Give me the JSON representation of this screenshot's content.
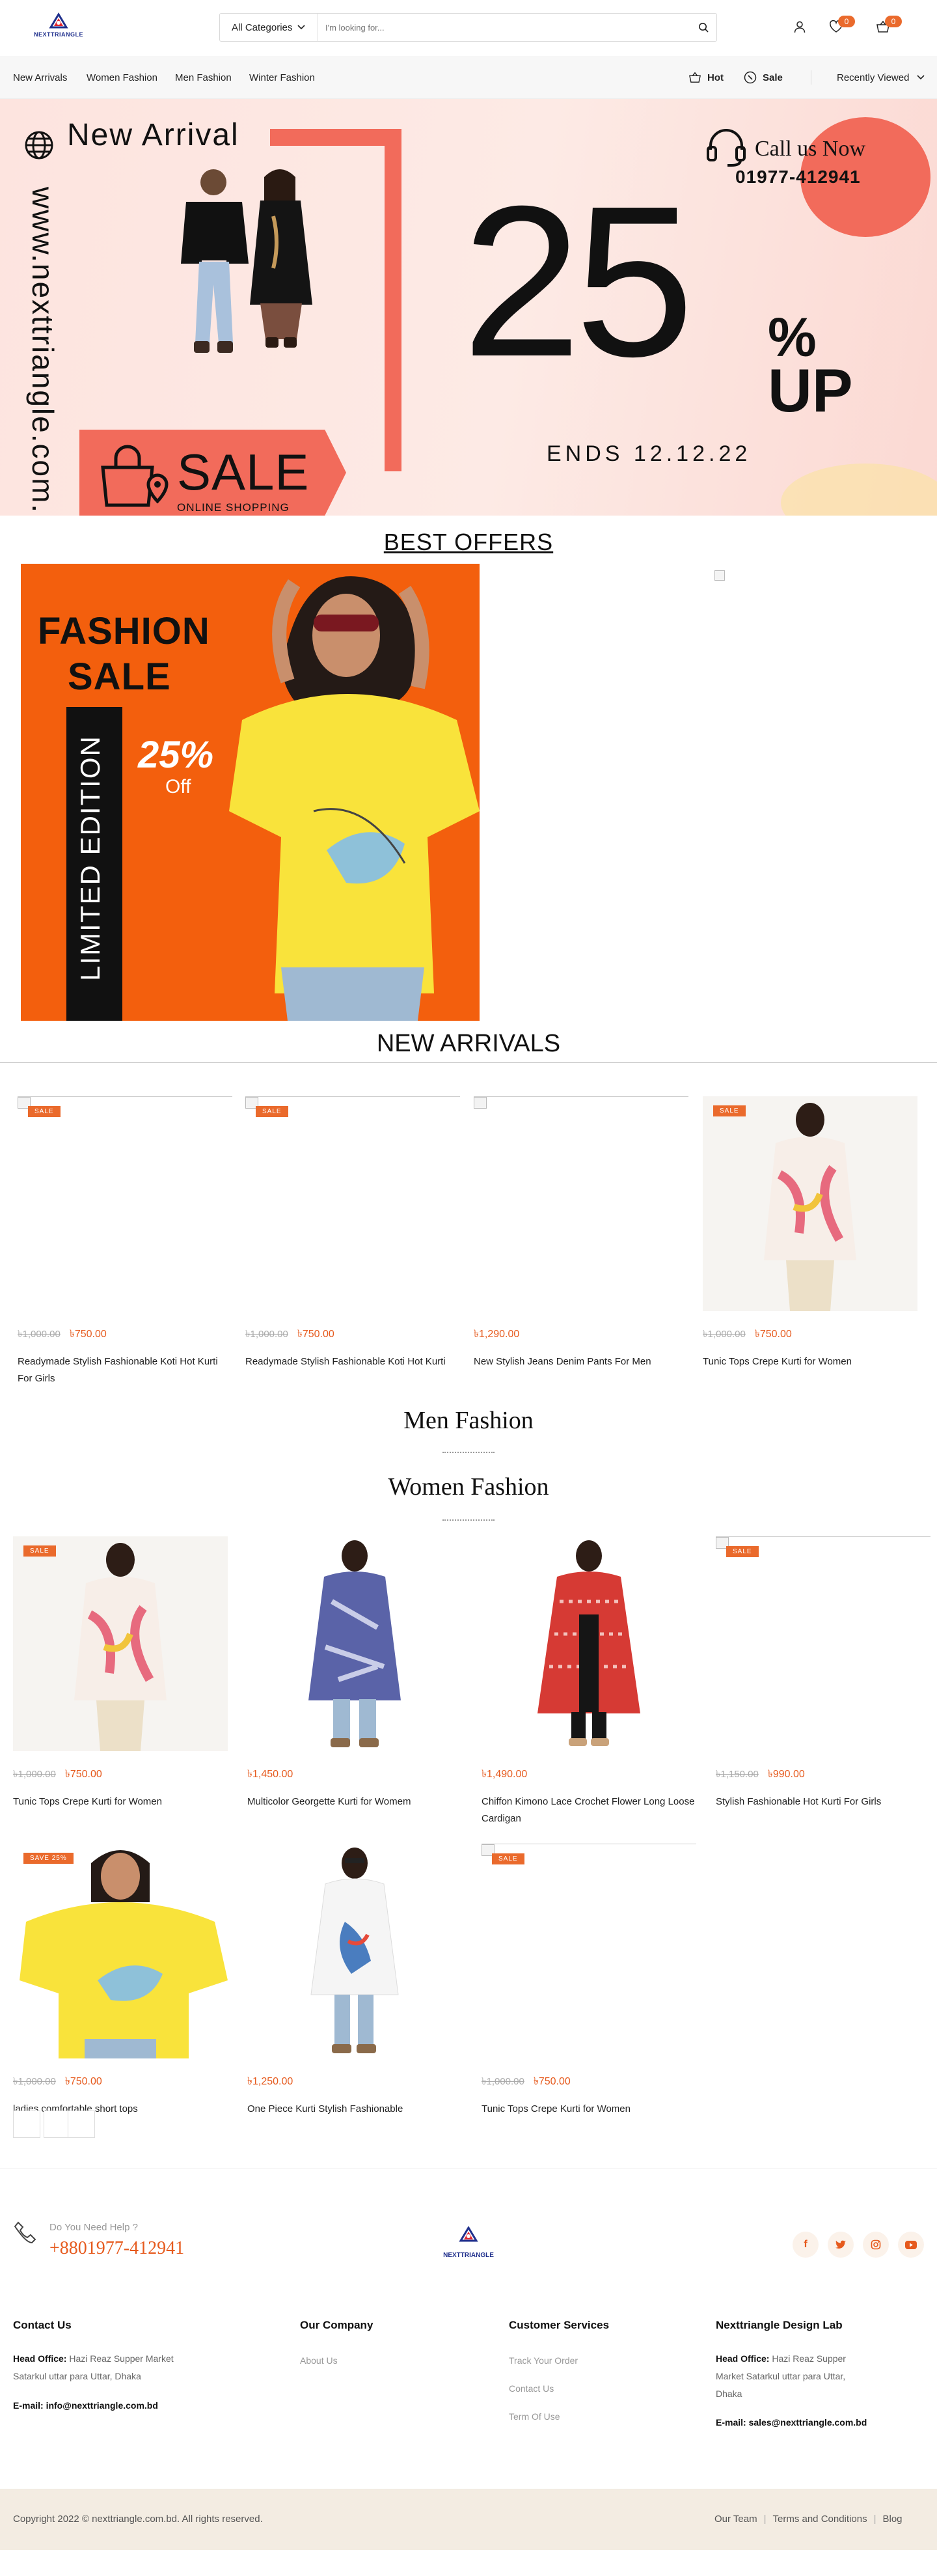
{
  "brand": {
    "logo_text": "NEXTTRIANGLE"
  },
  "search": {
    "category": "All Categories",
    "placeholder": "I'm looking for..."
  },
  "header": {
    "wishlist_count": "0",
    "cart_count": "0"
  },
  "nav": {
    "links": [
      "New Arrivals",
      "Women Fashion",
      "Men Fashion",
      "Winter Fashion"
    ],
    "hot": "Hot",
    "sale": "Sale",
    "recently_viewed": "Recently Viewed"
  },
  "hero": {
    "website": "www.nexttriangle.com.bd",
    "new_arrival": "New Arrival",
    "sale": "SALE",
    "online_shopping": "ONLINE SHOPPING",
    "call_label": "Call us Now",
    "phone": "01977-412941",
    "percent": "25",
    "percent_sign": "%",
    "up": "UP",
    "ends": "ENDS 12.12.22"
  },
  "best_offers": {
    "title": "BEST OFFERS",
    "banner": {
      "line1": "FASHION",
      "line2": "SALE",
      "edition": "LIMITED EDITION",
      "percent": "25%",
      "off": "Off"
    }
  },
  "new_arrivals": {
    "title": "NEW ARRIVALS",
    "products": [
      {
        "sale": "SALE",
        "old": "৳1,000.00",
        "price": "৳750.00",
        "name": "Readymade Stylish Fashionable Koti Hot Kurti For Girls"
      },
      {
        "sale": "SALE",
        "old": "৳1,000.00",
        "price": "৳750.00",
        "name": "Readymade Stylish Fashionable Koti Hot Kurti"
      },
      {
        "sale": "",
        "old": "",
        "price": "৳1,290.00",
        "name": "New Stylish Jeans Denim Pants For Men"
      },
      {
        "sale": "SALE",
        "old": "৳1,000.00",
        "price": "৳750.00",
        "name": "Tunic Tops Crepe Kurti for Women"
      }
    ]
  },
  "men_fashion": {
    "title": "Men Fashion"
  },
  "women_fashion": {
    "title": "Women Fashion",
    "products": [
      {
        "sale": "SALE",
        "old": "৳1,000.00",
        "price": "৳750.00",
        "name": "Tunic Tops Crepe Kurti for Women"
      },
      {
        "sale": "",
        "old": "",
        "price": "৳1,450.00",
        "name": "Multicolor Georgette Kurti for Womem"
      },
      {
        "sale": "",
        "old": "",
        "price": "৳1,490.00",
        "name": "Chiffon Kimono Lace Crochet Flower Long Loose Cardigan"
      },
      {
        "sale": "SALE",
        "old": "৳1,150.00",
        "price": "৳990.00",
        "name": "Stylish Fashionable Hot Kurti For Girls"
      },
      {
        "sale": "SAVE 25%",
        "old": "৳1,000.00",
        "price": "৳750.00",
        "name": "ladies comfortable short tops"
      },
      {
        "sale": "",
        "old": "",
        "price": "৳1,250.00",
        "name": "One Piece Kurti Stylish Fashionable"
      },
      {
        "sale": "SALE",
        "old": "৳1,000.00",
        "price": "৳750.00",
        "name": "Tunic Tops Crepe Kurti for Women"
      }
    ]
  },
  "footer": {
    "help_label": "Do You Need Help ?",
    "help_phone": "+8801977-412941",
    "contact": {
      "title": "Contact Us",
      "office_label": "Head Office:",
      "office": "Hazi Reaz Supper Market Satarkul uttar para Uttar, Dhaka",
      "email_label": "E-mail:",
      "email": "info@nexttriangle.com.bd"
    },
    "company": {
      "title": "Our Company",
      "links": [
        "About Us"
      ]
    },
    "services": {
      "title": "Customer Services",
      "links": [
        "Track Your Order",
        "Contact Us",
        "Term Of Use"
      ]
    },
    "lab": {
      "title": "Nexttriangle Design Lab",
      "office_label": "Head Office:",
      "office": "Hazi Reaz Supper Market Satarkul uttar para Uttar, Dhaka",
      "email_label": "E-mail:",
      "email": "sales@nexttriangle.com.bd"
    },
    "copyright": "Copyright 2022 © nexttriangle.com.bd. All rights reserved.",
    "bottom_links": [
      "Our Team",
      "Terms and Conditions",
      "Blog"
    ]
  },
  "colors": {
    "accent": "#ea6a2c",
    "banner_pink": "#fde4df",
    "coral": "#f26b5b",
    "orange": "#f35f0d",
    "yellow": "#f9e33b"
  }
}
